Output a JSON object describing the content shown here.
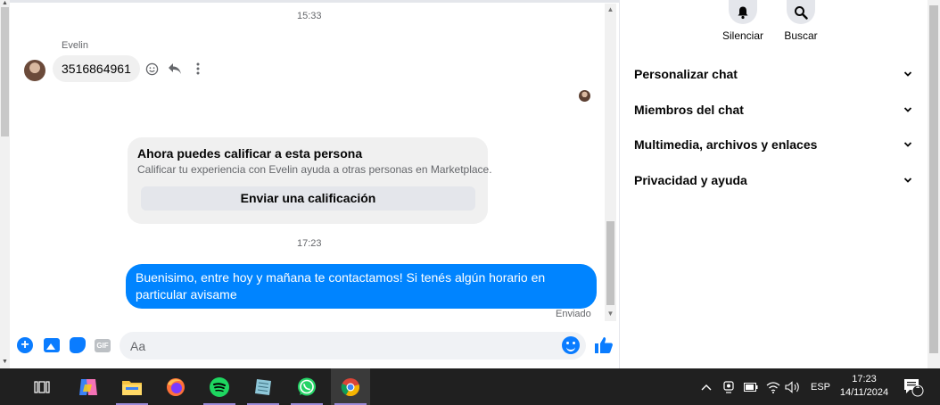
{
  "chat": {
    "time_top": "15:33",
    "sender_name": "Evelin",
    "incoming_message": "3516864961",
    "rating_card": {
      "title": "Ahora puedes calificar a esta persona",
      "subtitle": "Calificar tu experiencia con Evelin ayuda a otras personas en Marketplace.",
      "button": "Enviar una calificación"
    },
    "time_mid": "17:23",
    "outgoing_message": "Buenisimo, entre hoy y mañana te contactamos! Si tenés algún horario en particular avisame",
    "status": "Enviado"
  },
  "composer": {
    "placeholder": "Aa",
    "gif_label": "GIF"
  },
  "side": {
    "mute_label": "Silenciar",
    "search_label": "Buscar",
    "sections": [
      {
        "label": "Personalizar chat"
      },
      {
        "label": "Miembros del chat"
      },
      {
        "label": "Multimedia, archivos y enlaces"
      },
      {
        "label": "Privacidad y ayuda"
      }
    ]
  },
  "taskbar": {
    "language": "ESP",
    "time": "17:23",
    "date": "14/11/2024",
    "notification_count": "1"
  },
  "colors": {
    "messenger_blue": "#0084ff",
    "taskbar_bg": "#202020"
  }
}
